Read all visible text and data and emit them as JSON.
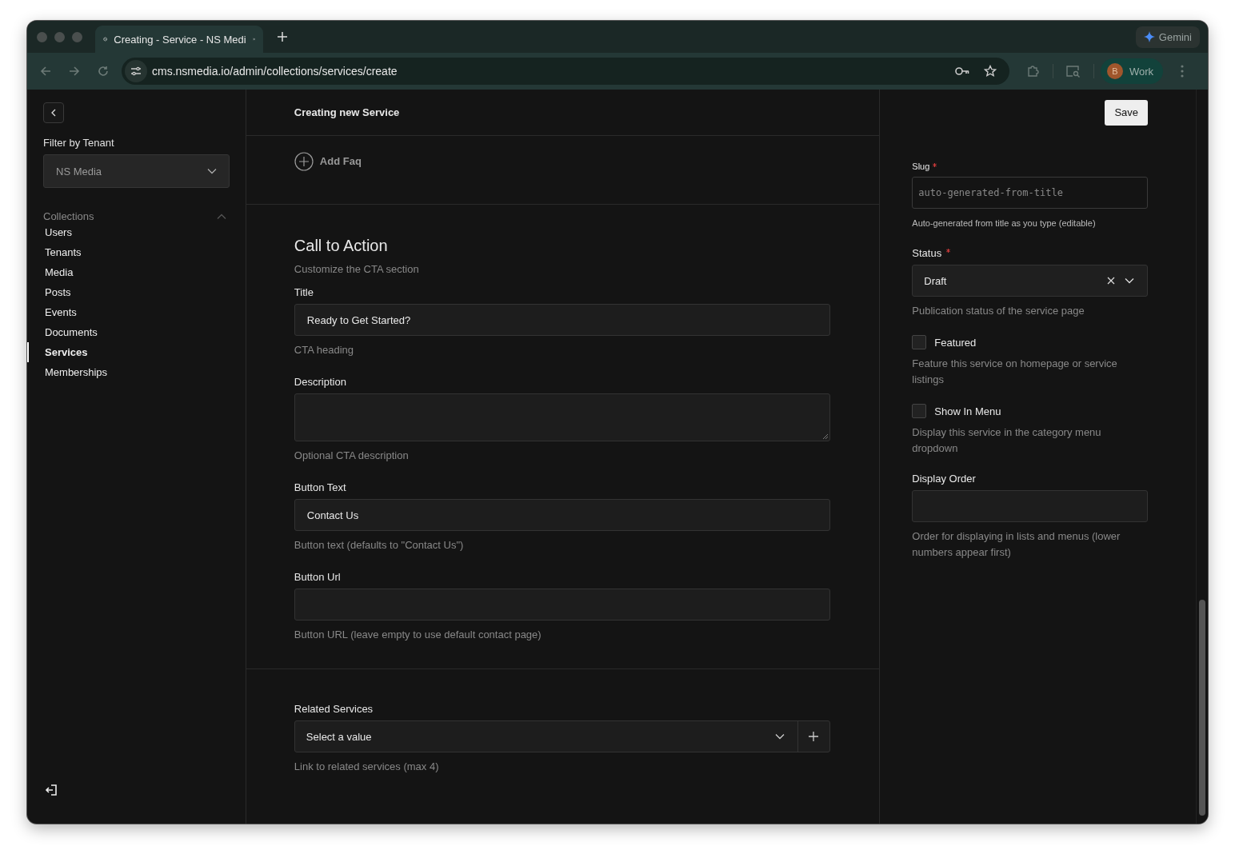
{
  "browser": {
    "tab_title": "Creating - Service - NS Medi",
    "url": "cms.nsmedia.io/admin/collections/services/create",
    "assistant_label": "Gemini",
    "profile": {
      "initial": "B",
      "label": "Work"
    }
  },
  "sidebar": {
    "tenant_filter": {
      "label": "Filter by Tenant",
      "value": "NS Media"
    },
    "collections": {
      "label": "Collections",
      "expanded": true,
      "items": [
        {
          "label": "Users",
          "selected": false
        },
        {
          "label": "Tenants",
          "selected": false
        },
        {
          "label": "Media",
          "selected": false
        },
        {
          "label": "Posts",
          "selected": false
        },
        {
          "label": "Events",
          "selected": false
        },
        {
          "label": "Documents",
          "selected": false
        },
        {
          "label": "Services",
          "selected": true
        },
        {
          "label": "Memberships",
          "selected": false
        }
      ]
    }
  },
  "header": {
    "title": "Creating new Service",
    "save_button": "Save"
  },
  "faq": {
    "add_button": "Add Faq"
  },
  "cta": {
    "heading": "Call to Action",
    "description": "Customize the CTA section",
    "fields": [
      {
        "kind": "input",
        "label": "Title",
        "value": "Ready to Get Started?",
        "help": "CTA heading"
      },
      {
        "kind": "textarea",
        "label": "Description",
        "help": "Optional CTA description"
      },
      {
        "kind": "input",
        "label": "Button Text",
        "value": "Contact Us",
        "help": "Button text (defaults to \"Contact Us\")"
      },
      {
        "kind": "input",
        "label": "Button Url",
        "help": "Button URL (leave empty to use default contact page)"
      }
    ]
  },
  "related": {
    "label": "Related Services",
    "placeholder": "Select a value",
    "help": "Link to related services (max 4)"
  },
  "side_fields": [
    {
      "kind": "text",
      "label": "Slug",
      "required": true,
      "placeholder": "auto-generated-from-title",
      "help": "Auto-generated from title as you type (editable)"
    },
    {
      "kind": "select",
      "label": "Status",
      "required": true,
      "value": "Draft",
      "help": "Publication status of the service page"
    },
    {
      "kind": "checkbox",
      "label": "Featured",
      "checked": false,
      "help": "Feature this service on homepage or service listings"
    },
    {
      "kind": "checkbox",
      "label": "Show In Menu",
      "checked": false,
      "help": "Display this service in the category menu dropdown"
    },
    {
      "kind": "number",
      "label": "Display Order",
      "help": "Order for displaying in lists and menus (lower numbers appear first)"
    }
  ]
}
